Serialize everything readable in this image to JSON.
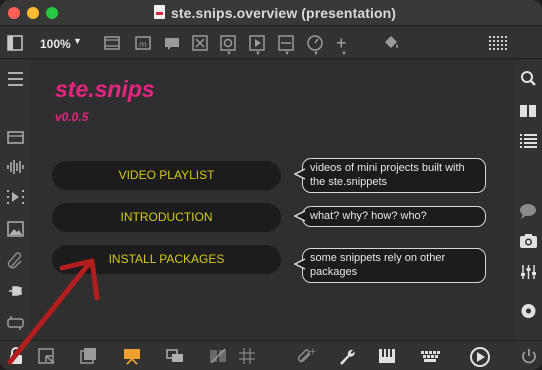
{
  "window": {
    "title": "ste.snips.overview (presentation)"
  },
  "toolbar": {
    "zoom": "100%",
    "icons": [
      "sidebar-toggle-icon",
      "object-box-icon",
      "message-box-icon",
      "comment-icon",
      "button-icon",
      "toggle-icon",
      "play-icon",
      "slider-icon",
      "dial-icon",
      "add-icon",
      "paint-bucket-icon",
      "grid-view-icon"
    ]
  },
  "canvas": {
    "app_title": "ste.snips",
    "version": "v0.0.5",
    "background": "#2f2f2f",
    "accent": "#e6247f",
    "button_text_color": "#d6c81f",
    "menu": [
      {
        "label": "VIDEO PLAYLIST",
        "description": "videos of mini projects built with the ste.snippets"
      },
      {
        "label": "INTRODUCTION",
        "description": "what? why? how? who?"
      },
      {
        "label": "INSTALL PACKAGES",
        "description": "some snippets rely on other packages"
      }
    ]
  },
  "left_sidebar": {
    "icons": [
      "menu-icon",
      "clipboard-icon",
      "audio-icon",
      "video-icon",
      "image-icon",
      "paperclip-icon",
      "plug-icon",
      "patch-cord-icon"
    ]
  },
  "right_sidebar": {
    "icons": [
      "search-icon",
      "book-icon",
      "list-icon",
      "chat-icon",
      "camera-icon",
      "mixer-icon",
      "record-icon"
    ]
  },
  "bottom_bar": {
    "icons": [
      "lock-icon",
      "presentation-icon",
      "background-icon",
      "presentation-mode-icon",
      "layers-icon",
      "hide-icon",
      "grid-icon",
      "debug-icon",
      "wrench-icon",
      "piano-icon",
      "keyboard-icon",
      "transport-icon",
      "power-icon"
    ]
  },
  "annotation": {
    "arrow_color": "#b01e1e"
  }
}
